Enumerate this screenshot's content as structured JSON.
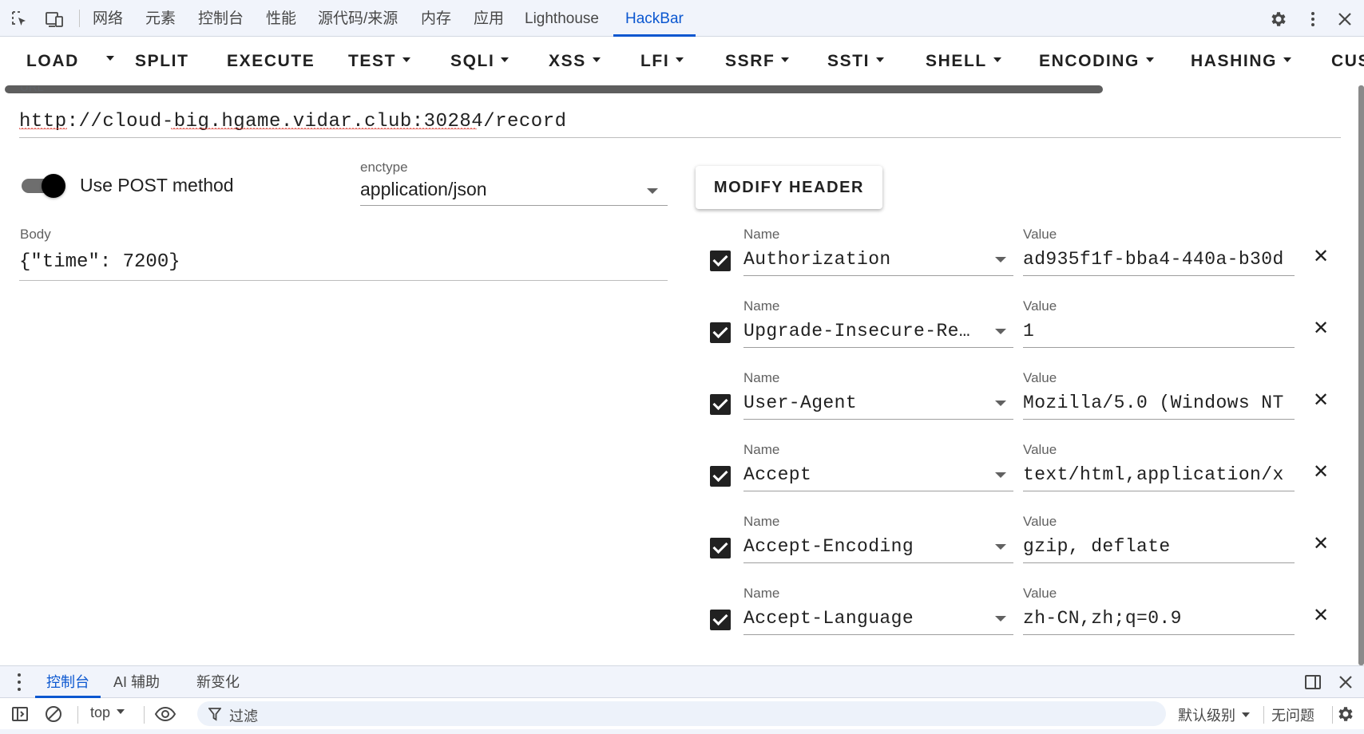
{
  "devtools": {
    "tabs": [
      {
        "label": "网络"
      },
      {
        "label": "元素"
      },
      {
        "label": "控制台"
      },
      {
        "label": "性能"
      },
      {
        "label": "源代码/来源"
      },
      {
        "label": "内存"
      },
      {
        "label": "应用"
      },
      {
        "label": "Lighthouse"
      },
      {
        "label": "HackBar",
        "active": true
      }
    ],
    "accent_color": "#0b57d0"
  },
  "hackbar": {
    "menu": {
      "load": "LOAD",
      "split": "SPLIT",
      "execute": "EXECUTE",
      "test": "TEST",
      "sqli": "SQLI",
      "xss": "XSS",
      "lfi": "LFI",
      "ssrf": "SSRF",
      "ssti": "SSTI",
      "shell": "SHELL",
      "encoding": "ENCODING",
      "hashing": "HASHING",
      "custom": "CUS"
    },
    "url": {
      "label": "URL",
      "value": "http://cloud-big.hgame.vidar.club:30284/record"
    },
    "post_toggle": {
      "label": "Use POST method",
      "on": true
    },
    "enctype": {
      "label": "enctype",
      "value": "application/json"
    },
    "modify_header_label": "MODIFY HEADER",
    "body": {
      "label": "Body",
      "value": "{\"time\": 7200}"
    },
    "headers": [
      {
        "name_label": "Name",
        "value_label": "Value",
        "name": "Authorization",
        "value": "ad935f1f-bba4-440a-b30d",
        "checked": true
      },
      {
        "name_label": "Name",
        "value_label": "Value",
        "name": "Upgrade-Insecure-Requests",
        "value": "1",
        "checked": true
      },
      {
        "name_label": "Name",
        "value_label": "Value",
        "name": "User-Agent",
        "value": "Mozilla/5.0 (Windows NT",
        "checked": true
      },
      {
        "name_label": "Name",
        "value_label": "Value",
        "name": "Accept",
        "value": "text/html,application/x",
        "checked": true
      },
      {
        "name_label": "Name",
        "value_label": "Value",
        "name": "Accept-Encoding",
        "value": "gzip, deflate",
        "checked": true
      },
      {
        "name_label": "Name",
        "value_label": "Value",
        "name": "Accept-Language",
        "value": "zh-CN,zh;q=0.9",
        "checked": true
      }
    ]
  },
  "drawer": {
    "tabs": [
      {
        "label": "控制台",
        "active": true
      },
      {
        "label": "AI 辅助"
      },
      {
        "label": "新变化"
      }
    ],
    "context": "top",
    "filter_placeholder": "过滤",
    "level": "默认级别",
    "issues": "无问题"
  }
}
